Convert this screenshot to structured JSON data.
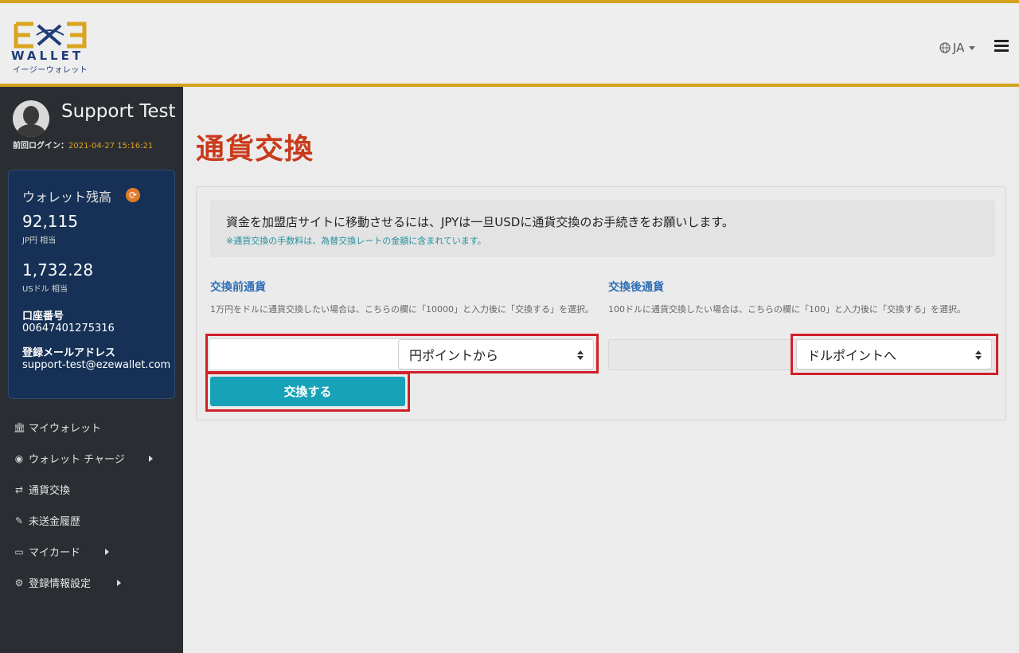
{
  "header": {
    "logo_text": "EZE",
    "logo_wallet": "WALLET",
    "logo_kana": "イージーウォレット",
    "language": "JA",
    "colors": {
      "accent": "#d4a31a",
      "brand_blue": "#1f3d7a"
    }
  },
  "user": {
    "name": "Support Test",
    "last_login_label": "前回ログイン：",
    "last_login_time": "2021-04-27 15:16:21"
  },
  "balance": {
    "title": "ウォレット残高",
    "jpy_value": "92,115",
    "jpy_label": "JP円 相当",
    "usd_value": "1,732.28",
    "usd_label": "USドル 相当",
    "account_label": "口座番号",
    "account_value": "00647401275316",
    "email_label": "登録メールアドレス",
    "email_value": "support-test@ezewallet.com"
  },
  "sidebar": {
    "items": [
      {
        "label": "マイウォレット",
        "icon": "bank-icon"
      },
      {
        "label": "ウォレット チャージ",
        "icon": "charge-icon",
        "has_submenu": true
      },
      {
        "label": "通貨交換",
        "icon": "exchange-icon"
      },
      {
        "label": "未送金履歴",
        "icon": "history-icon"
      },
      {
        "label": "マイカード",
        "icon": "card-icon",
        "has_submenu": true
      },
      {
        "label": "登録情報設定",
        "icon": "gear-icon",
        "has_submenu": true
      }
    ]
  },
  "main": {
    "title": "通貨交換",
    "notice": "資金を加盟店サイトに移動させるには、JPYは一旦USDに通貨交換のお手続きをお願いします。",
    "notice_sub": "※通貨交換の手数料は、為替交換レートの金額に含まれています。",
    "from": {
      "title": "交換前通貨",
      "help": "1万円をドルに通貨交換したい場合は、こちらの欄に「10000」と入力後に「交換する」を選択。",
      "amount_value": "",
      "select_value": "円ポイントから"
    },
    "to": {
      "title": "交換後通貨",
      "help": "100ドルに通貨交換したい場合は、こちらの欄に「100」と入力後に「交換する」を選択。",
      "amount_value": "",
      "select_value": "ドルポイントへ"
    },
    "exchange_button": "交換する",
    "colors": {
      "title": "#c93a1b",
      "button": "#17a2b8",
      "highlight": "#d0202a"
    }
  }
}
